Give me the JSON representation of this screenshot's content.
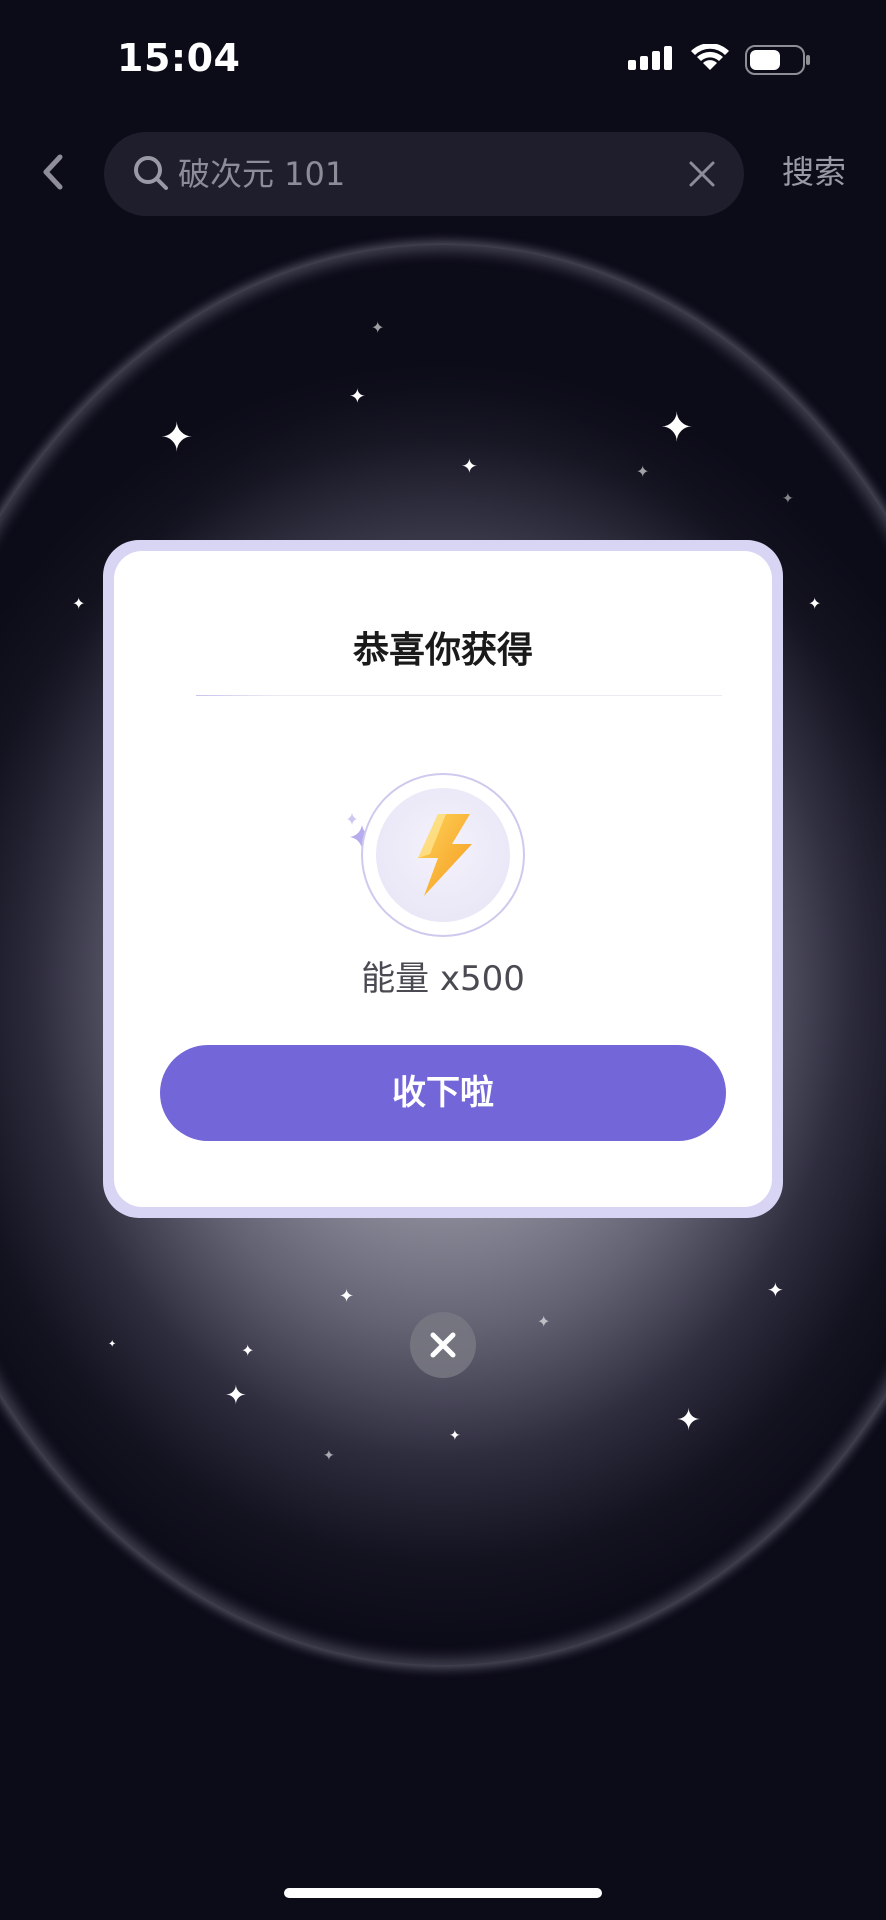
{
  "status_bar": {
    "time": "15:04",
    "icons": [
      "signal-icon",
      "wifi-icon",
      "battery-icon"
    ]
  },
  "header": {
    "back_icon": "chevron-left-icon",
    "search": {
      "icon": "search-icon",
      "query": "破次元 101",
      "clear_icon": "close-icon"
    },
    "search_button_label": "搜索"
  },
  "popup": {
    "title": "恭喜你获得",
    "reward": {
      "icon": "lightning-icon",
      "label": "能量 x500"
    },
    "accept_label": "收下啦"
  },
  "close_icon": "close-icon",
  "colors": {
    "accent": "#7366d9",
    "popup_border": "#d8d4f4",
    "background": "#0c0b18",
    "reward_gold": "#f7b531"
  }
}
